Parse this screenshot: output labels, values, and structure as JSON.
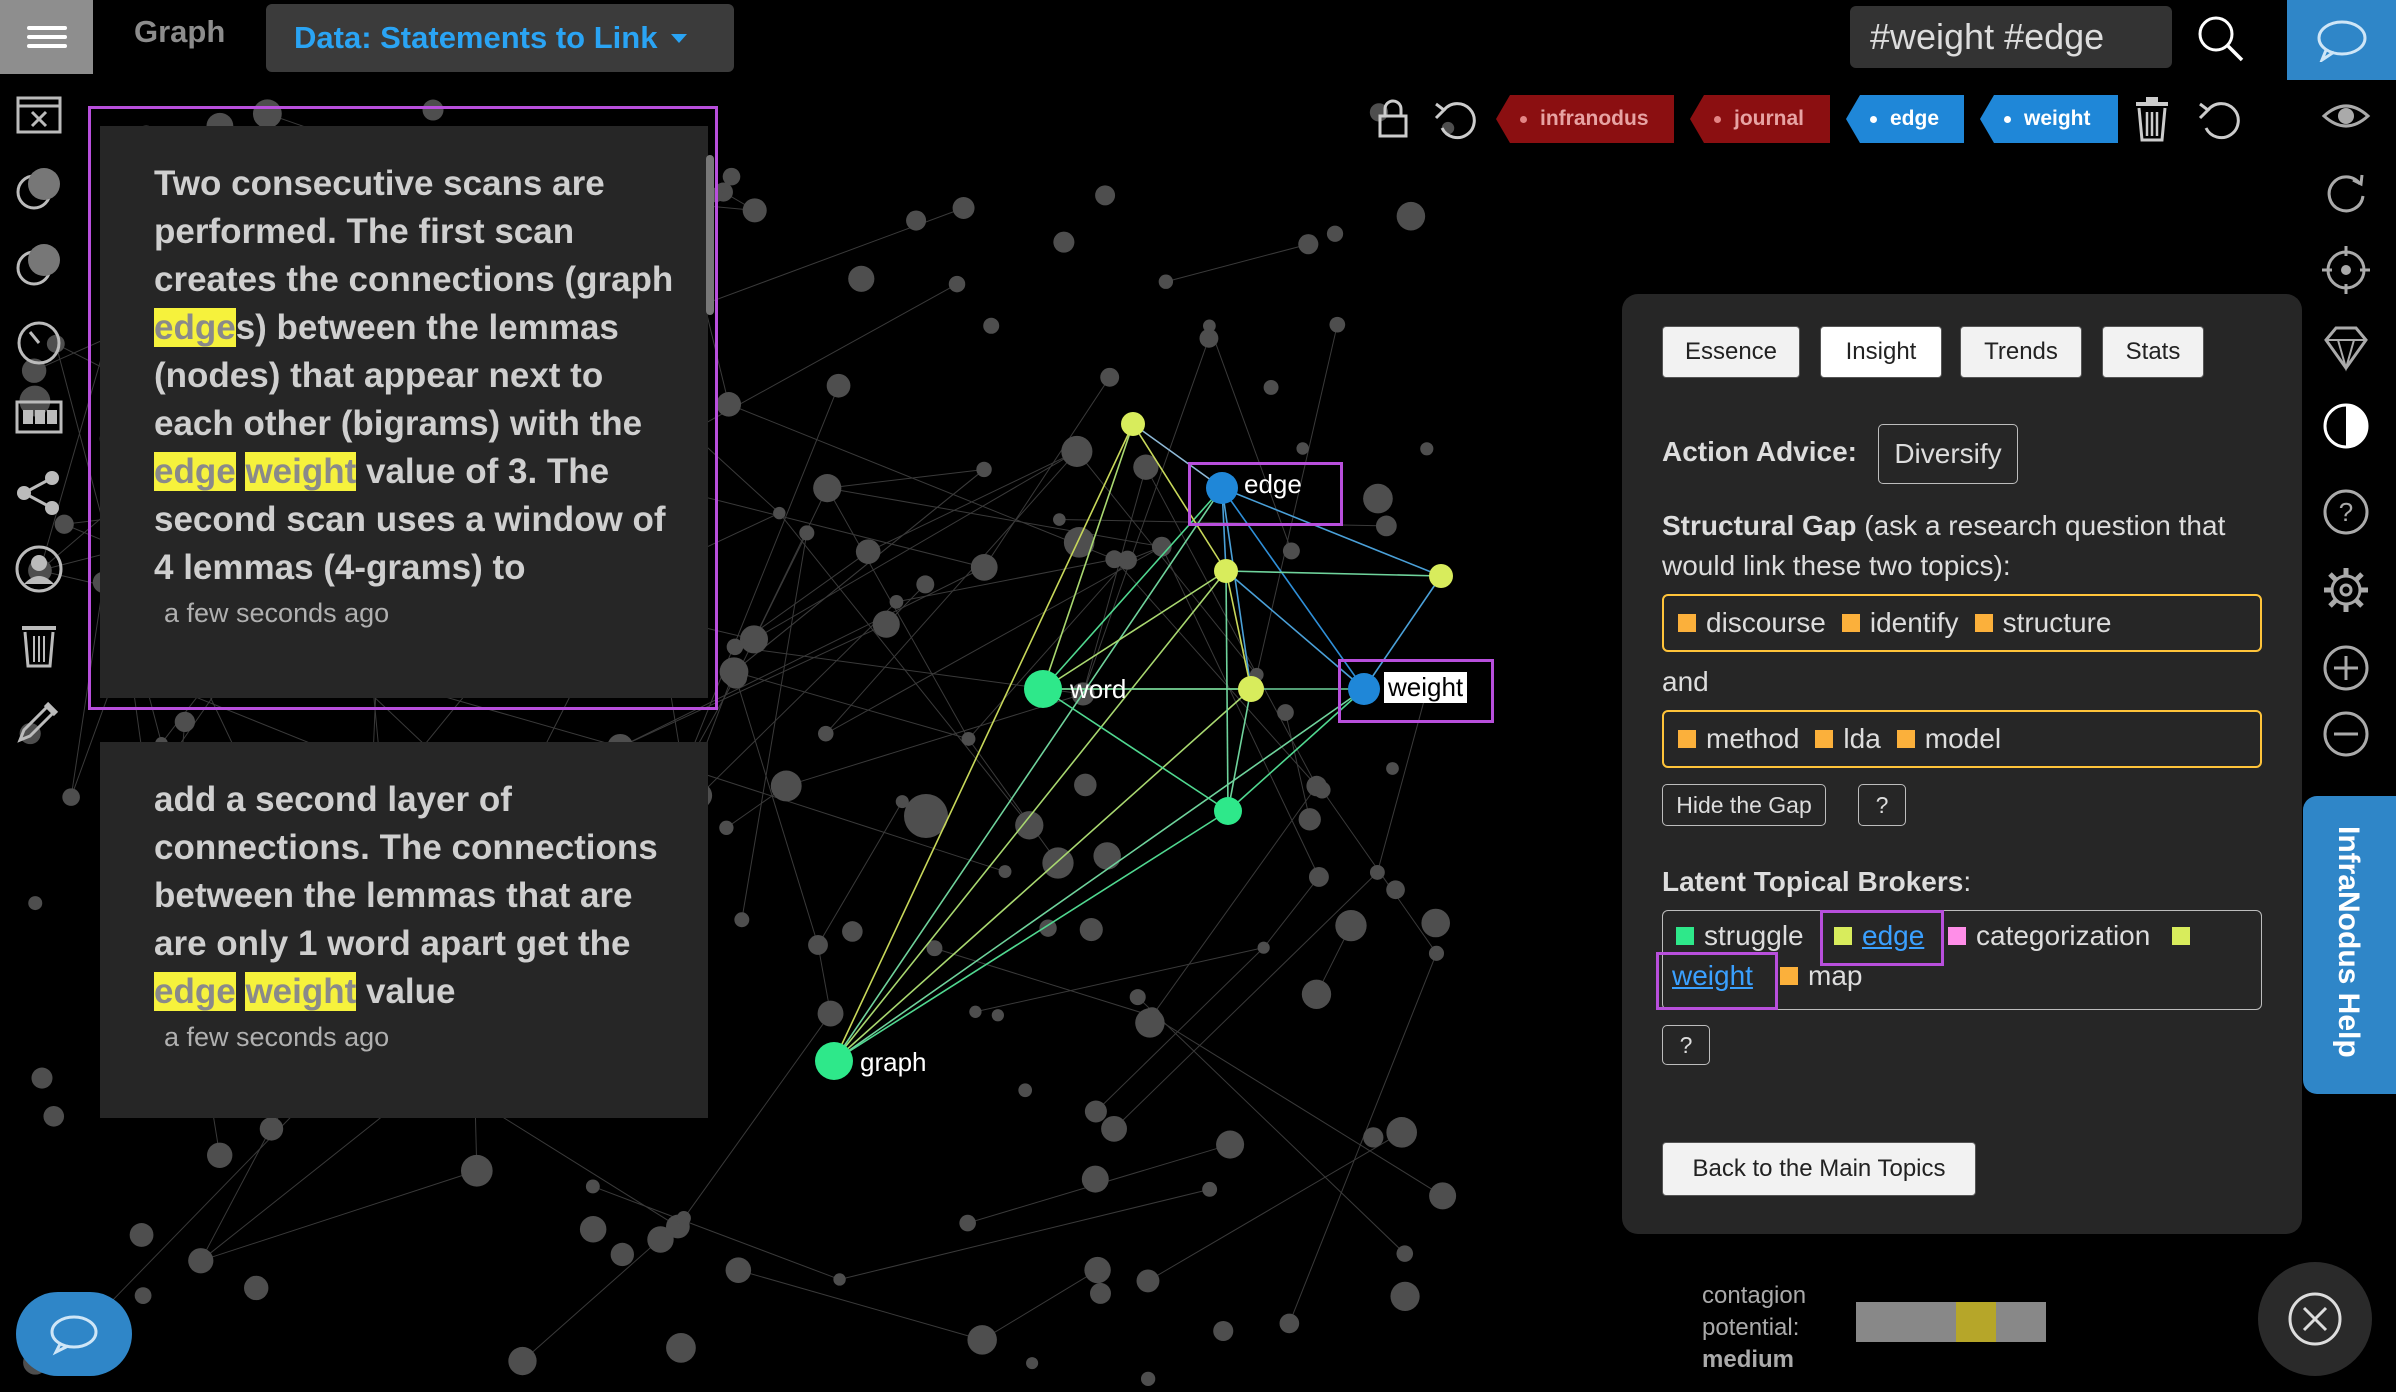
{
  "topbar": {
    "graph_tab": "Graph",
    "dataset_label": "Data: Statements to Link",
    "search_value": "#weight #edge"
  },
  "tags": [
    {
      "label": "infranodus",
      "color": "#8b0f11"
    },
    {
      "label": "journal",
      "color": "#8b0f11"
    },
    {
      "label": "edge",
      "color": "#1f87d8"
    },
    {
      "label": "weight",
      "color": "#1f87d8"
    }
  ],
  "statements": [
    {
      "parts": [
        "Two consecutive scans are performed. The first scan creates the connections (graph ",
        "edge",
        "s) between the lemmas (nodes) that appear next to each other (bigrams) with the ",
        "edge",
        " ",
        "weight",
        " value of 3. The second scan uses a window of 4 lemmas (4-grams) to"
      ],
      "time": "a few seconds ago"
    },
    {
      "parts": [
        "add a second layer of connections. The connections between the lemmas that are are only 1 word apart get the ",
        "edge",
        " ",
        "weight",
        " value"
      ],
      "time": "a few seconds ago"
    }
  ],
  "graph_labels": {
    "edge": "edge",
    "weight": "weight",
    "word": "word",
    "graph": "graph"
  },
  "panel": {
    "tabs": [
      "Essence",
      "Insight",
      "Trends",
      "Stats"
    ],
    "active_tab": "Insight",
    "action_advice_label": "Action Advice:",
    "action_advice_value": "Diversify",
    "gap_title": "Structural Gap",
    "gap_desc": " (ask a research question that would link these two topics):",
    "gap_topic1": [
      "discourse",
      "identify",
      "structure"
    ],
    "and_label": "and",
    "gap_topic2": [
      "method",
      "lda",
      "model"
    ],
    "hide_gap_label": "Hide the Gap",
    "help_q": "?",
    "brokers_title": "Latent Topical Brokers",
    "brokers_colon": ":",
    "brokers": {
      "struggle": "struggle",
      "edge": "edge",
      "categorization": "categorization",
      "weight": "weight",
      "map": "map"
    },
    "back_label": "Back to the Main Topics"
  },
  "help_tab": "InfraNodus Help",
  "contagion": {
    "label1": "contagion",
    "label2": "potential:",
    "level": "medium"
  },
  "colors": {
    "accent_blue": "#2aa4f4",
    "highlight_yellow": "#f6f23c",
    "selection_purple": "#b84fdc",
    "gap_border": "#ffc43a",
    "node_green": "#2ee88a",
    "node_lime": "#d8ec5c",
    "node_blue": "#1f87d8"
  }
}
